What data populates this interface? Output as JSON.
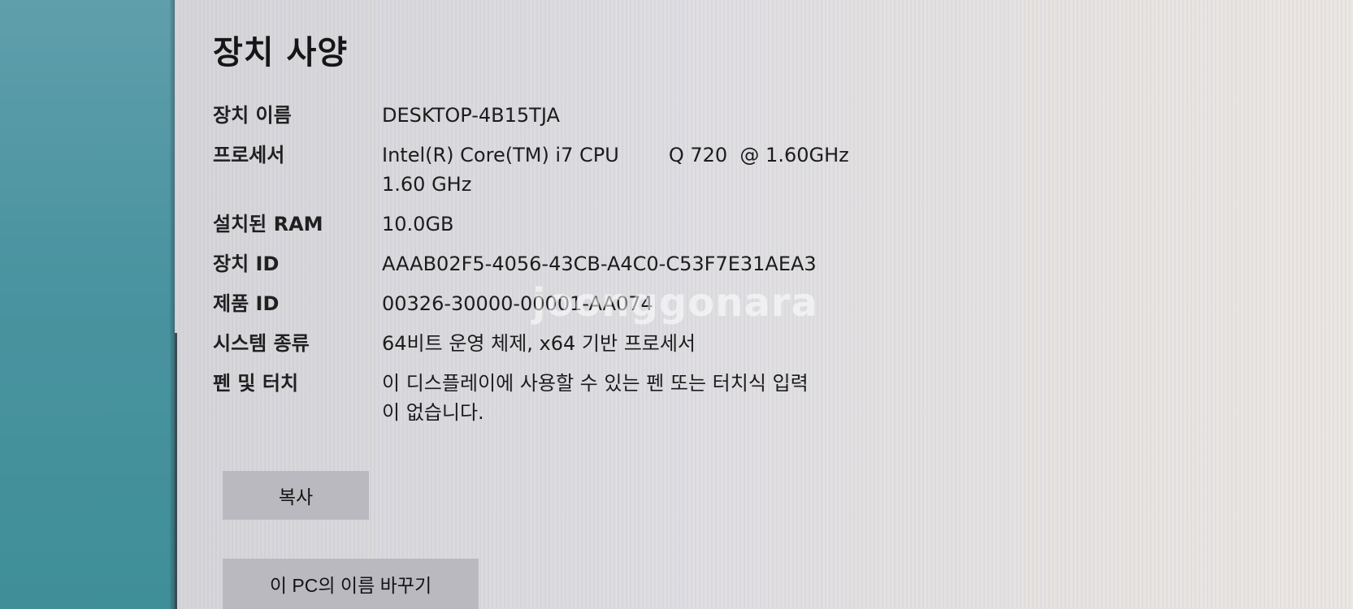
{
  "page": {
    "title": "장치 사양"
  },
  "specs": [
    {
      "label": "장치 이름",
      "value_lines": [
        "DESKTOP-4B15TJA"
      ]
    },
    {
      "label": "프로세서",
      "value_lines": [
        "Intel(R) Core(TM) i7 CPU        Q 720  @ 1.60GHz",
        "1.60 GHz"
      ]
    },
    {
      "label": "설치된 RAM",
      "value_lines": [
        "10.0GB"
      ]
    },
    {
      "label": "장치 ID",
      "value_lines": [
        "AAAB02F5-4056-43CB-A4C0-C53F7E31AEA3"
      ]
    },
    {
      "label": "제품 ID",
      "value_lines": [
        "00326-30000-00001-AA074"
      ]
    },
    {
      "label": "시스템 종류",
      "value_lines": [
        "64비트 운영 체제, x64 기반 프로세서"
      ]
    },
    {
      "label": "펜 및 터치",
      "value_lines": [
        "이 디스플레이에 사용할 수 있는 펜 또는 터치식 입력",
        "이 없습니다."
      ]
    }
  ],
  "buttons": {
    "copy_label": "복사",
    "rename_label": "이 PC의 이름 바꾸기"
  },
  "watermark": {
    "text": "joonggonara"
  },
  "colors": {
    "sidebar": "#4a93a0",
    "button_bg": "#b9b9bf"
  }
}
